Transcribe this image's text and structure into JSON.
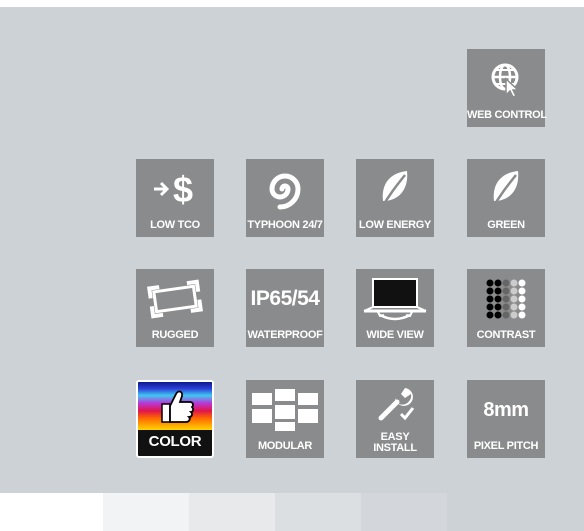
{
  "tiles": {
    "web_control": "WEB CONTROL",
    "low_tco": "LOW TCO",
    "typhoon": "TYPHOON 24/7",
    "low_energy": "LOW ENERGY",
    "green": "GREEN",
    "rugged": "RUGGED",
    "ip_rating": "IP65/54",
    "waterproof": "WATERPROOF",
    "wide_view": "WIDE VIEW",
    "contrast": "CONTRAST",
    "color": "COLOR",
    "modular": "MODULAR",
    "easy_install_line1": "EASY",
    "easy_install_line2": "INSTALL",
    "pixel_pitch_value": "8mm",
    "pixel_pitch": "PIXEL PITCH"
  },
  "colors": {
    "panel": "#cdd2d6",
    "tile": "#8a8b8c",
    "text": "#ffffff"
  },
  "icons": [
    "globe-cursor-icon",
    "dollar-arrow-icon",
    "swirl-icon",
    "leaf-icon",
    "leaf-icon",
    "frame-corners-icon",
    "wide-screen-icon",
    "dot-grid-icon",
    "thumbs-up-icon",
    "brick-wall-icon",
    "wrench-check-icon"
  ]
}
